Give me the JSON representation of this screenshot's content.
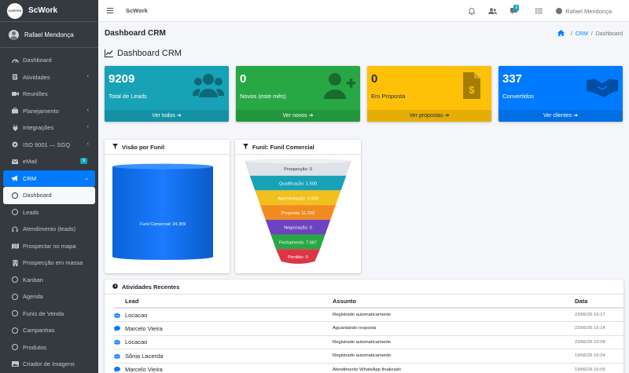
{
  "app": {
    "logo_text": "CORTEX",
    "brand": "ScWork",
    "user_name": "Rafael Mendonça"
  },
  "sidebar": {
    "items": [
      {
        "label": "Dashboard",
        "icon": "dashboard-icon",
        "chevron": false
      },
      {
        "label": "Atividades",
        "icon": "tasks-icon",
        "chevron": true
      },
      {
        "label": "Reuniões",
        "icon": "video-icon",
        "chevron": false
      },
      {
        "label": "Planejamento",
        "icon": "briefcase-icon",
        "chevron": true
      },
      {
        "label": "Integrações",
        "icon": "plug-icon",
        "chevron": true
      },
      {
        "label": "ISO 9001 — SGQ",
        "icon": "certificate-icon",
        "chevron": true
      },
      {
        "label": "eMail",
        "icon": "envelope-icon",
        "badge": "9"
      },
      {
        "label": "CRM",
        "icon": "bullhorn-icon",
        "chevron": true
      },
      {
        "label": "Dashboard",
        "icon": "circle-icon"
      },
      {
        "label": "Leads",
        "icon": "circle-icon"
      },
      {
        "label": "Atendimento (leads)",
        "icon": "headset-icon"
      },
      {
        "label": "Prospectar no mapa",
        "icon": "map-icon"
      },
      {
        "label": "Prospecção em massa",
        "icon": "building-icon"
      },
      {
        "label": "Kanban",
        "icon": "circle-icon"
      },
      {
        "label": "Agenda",
        "icon": "circle-icon"
      },
      {
        "label": "Funis de Venda",
        "icon": "circle-icon"
      },
      {
        "label": "Campanhas",
        "icon": "circle-icon"
      },
      {
        "label": "Produtos",
        "icon": "circle-icon"
      },
      {
        "label": "Criador de Imagens",
        "icon": "image-icon"
      }
    ]
  },
  "topbar": {
    "title": "ScWork",
    "chat_badge": "9",
    "user_name": "Rafael Mendonça"
  },
  "page": {
    "title": "Dashboard CRM",
    "breadcrumb_crm": "CRM",
    "breadcrumb_current": "Dashboard",
    "section_title": "Dashboard CRM"
  },
  "boxes": [
    {
      "value": "9209",
      "label": "Total de Leads",
      "link": "Ver todos",
      "color": "#17a2b8",
      "icon": "users-icon"
    },
    {
      "value": "0",
      "label": "Novos (este mês)",
      "link": "Ver novos",
      "color": "#28a745",
      "icon": "user-plus-icon"
    },
    {
      "value": "0",
      "label": "Em Proposta",
      "link": "Ver propostas",
      "color": "#ffc107",
      "icon": "file-invoice-dollar-icon"
    },
    {
      "value": "337",
      "label": "Convertidos",
      "link": "Ver clientes",
      "color": "#007bff",
      "icon": "handshake-icon"
    }
  ],
  "funnel_overview": {
    "title": "Visão por Funil",
    "cylinder_label": "Funil Comercial: 24.359"
  },
  "funnel_chart": {
    "title": "Funil: Funil Comercial"
  },
  "chart_data": {
    "type": "funnel",
    "stages": [
      {
        "name": "Prospecção",
        "value": "0",
        "color": "#dfe3e8"
      },
      {
        "name": "Qualificação",
        "value": "1.500",
        "color": "#17a2b8"
      },
      {
        "name": "Apresentação",
        "value": "3.900",
        "color": "#f2c01c"
      },
      {
        "name": "Proposta",
        "value": "11.292",
        "color": "#f28b1f"
      },
      {
        "name": "Negociação",
        "value": "0",
        "color": "#6f42c1"
      },
      {
        "name": "Fechamento",
        "value": "7.667",
        "color": "#28a745"
      },
      {
        "name": "Perdido",
        "value": "0",
        "color": "#dc3545"
      }
    ]
  },
  "activities": {
    "title": "Atividades Recentes",
    "columns": [
      "Lead",
      "Assunto",
      "Data"
    ],
    "rows": [
      {
        "lead": "Locacao",
        "subject": "Registrado automaticamente",
        "date": "23/06/26 16:17"
      },
      {
        "lead": "Marcelo Vieira",
        "subject": "Aguardando resposta",
        "date": "23/06/26 15:14"
      },
      {
        "lead": "Locacao",
        "subject": "Registrado automaticamente",
        "date": "23/06/26 10:58"
      },
      {
        "lead": "Sônia Lacerda",
        "subject": "Registrado automaticamente",
        "date": "19/06/26 16:24"
      },
      {
        "lead": "Marcelo Vieira",
        "subject": "Atendimento WhatsApp finalizado",
        "date": "19/06/26 16:05"
      }
    ]
  }
}
